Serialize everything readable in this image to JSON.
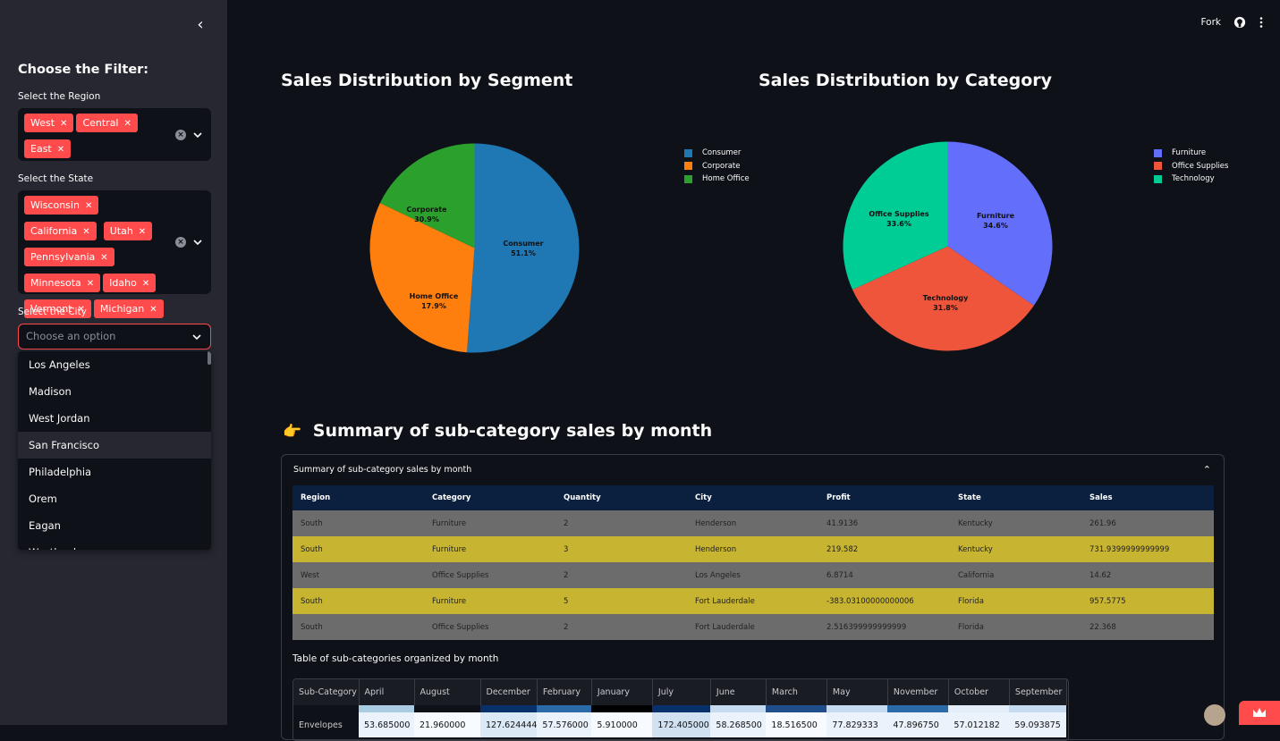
{
  "sidebar": {
    "title": "Choose the Filter:",
    "region": {
      "label": "Select the Region",
      "chips": [
        "West",
        "Central",
        "East"
      ]
    },
    "state": {
      "label": "Select the State",
      "chips": [
        "Wisconsin",
        "California",
        "Utah",
        "Pennsylvania",
        "Minnesota",
        "Idaho",
        "Vermont",
        "Michigan"
      ]
    },
    "city": {
      "label": "Select the City",
      "placeholder": "Choose an option",
      "options": [
        "Los Angeles",
        "Madison",
        "West Jordan",
        "San Francisco",
        "Philadelphia",
        "Orem",
        "Eagan",
        "Westland"
      ],
      "highlighted": "San Francisco"
    }
  },
  "topbar": {
    "fork_label": "Fork"
  },
  "segment_chart": {
    "title": "Sales Distribution by Segment",
    "legend": [
      "Consumer",
      "Corporate",
      "Home Office"
    ],
    "labels": [
      {
        "name": "Consumer",
        "pct": "51.1%"
      },
      {
        "name": "Corporate",
        "pct": "30.9%"
      },
      {
        "name": "Home Office",
        "pct": "17.9%"
      }
    ]
  },
  "category_chart": {
    "title": "Sales Distribution by Category",
    "legend": [
      "Furniture",
      "Office Supplies",
      "Technology"
    ],
    "labels": [
      {
        "name": "Furniture",
        "pct": "34.6%"
      },
      {
        "name": "Office Supplies",
        "pct": "33.6%"
      },
      {
        "name": "Technology",
        "pct": "31.8%"
      }
    ]
  },
  "summary": {
    "heading_emoji": "👉",
    "heading": "Summary of sub-category sales by month",
    "expander_title": "Summary of sub-category sales by month",
    "table": {
      "columns": [
        "Region",
        "Category",
        "Quantity",
        "City",
        "Profit",
        "State",
        "Sales"
      ],
      "rows": [
        [
          "South",
          "Furniture",
          "2",
          "Henderson",
          "41.9136",
          "Kentucky",
          "261.96"
        ],
        [
          "South",
          "Furniture",
          "3",
          "Henderson",
          "219.582",
          "Kentucky",
          "731.9399999999999"
        ],
        [
          "West",
          "Office Supplies",
          "2",
          "Los Angeles",
          "6.8714",
          "California",
          "14.62"
        ],
        [
          "South",
          "Furniture",
          "5",
          "Fort Lauderdale",
          "-383.03100000000006",
          "Florida",
          "957.5775"
        ],
        [
          "South",
          "Office Supplies",
          "2",
          "Fort Lauderdale",
          "2.516399999999999",
          "Florida",
          "22.368"
        ]
      ]
    },
    "month_table_title": "Table of sub-categories organized by month",
    "month_table": {
      "columns": [
        "Sub-Category",
        "April",
        "August",
        "December",
        "February",
        "January",
        "July",
        "June",
        "March",
        "May",
        "November",
        "October",
        "September"
      ],
      "rows": [
        [
          "Envelopes",
          "53.685000",
          "21.960000",
          "127.624444",
          "57.576000",
          "5.910000",
          "172.405000",
          "58.268500",
          "18.516500",
          "77.829333",
          "47.896750",
          "57.012182",
          "59.093875"
        ]
      ]
    }
  },
  "chart_data": [
    {
      "type": "pie",
      "title": "Sales Distribution by Segment",
      "categories": [
        "Consumer",
        "Corporate",
        "Home Office"
      ],
      "values": [
        51.1,
        30.9,
        17.9
      ],
      "colors": [
        "#1f77b4",
        "#ff7f0e",
        "#2ca02c"
      ],
      "legend": "top-right"
    },
    {
      "type": "pie",
      "title": "Sales Distribution by Category",
      "categories": [
        "Furniture",
        "Office Supplies",
        "Technology"
      ],
      "values": [
        34.6,
        33.6,
        31.8
      ],
      "colors": [
        "#636efa",
        "#ef553b",
        "#00cc96"
      ],
      "legend": "top-right"
    }
  ],
  "colors": {
    "accent": "#ff4b4b",
    "row_gray": "#6c6c6c",
    "row_yellow": "#c7b430",
    "header_navy": "#0b1f3f"
  }
}
